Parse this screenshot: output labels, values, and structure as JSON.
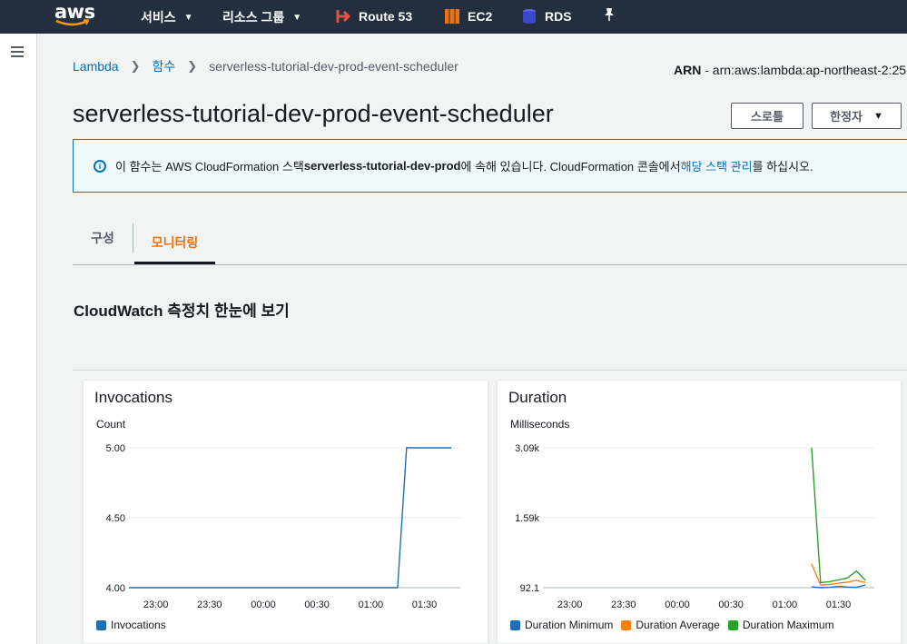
{
  "nav": {
    "logo_text": "aws",
    "services_label": "서비스",
    "resource_groups_label": "리소스 그룹",
    "shortcuts": [
      {
        "label": "Route 53",
        "color": "#e05243",
        "icon": "route53-icon"
      },
      {
        "label": "EC2",
        "color": "#ec7211",
        "icon": "ec2-icon"
      },
      {
        "label": "RDS",
        "color": "#3b48cc",
        "icon": "rds-icon"
      }
    ],
    "pin_icon": "pin-icon"
  },
  "breadcrumb": {
    "root": "Lambda",
    "functions": "함수",
    "current": "serverless-tutorial-dev-prod-event-scheduler"
  },
  "arn": {
    "label": "ARN",
    "value": " - arn:aws:lambda:ap-northeast-2:25"
  },
  "page": {
    "title": "serverless-tutorial-dev-prod-event-scheduler",
    "throttle_label": "스로틀",
    "actions_label": "한정자"
  },
  "info": {
    "prefix": "이 함수는 AWS CloudFormation 스택 ",
    "stack_name": "serverless-tutorial-dev-prod",
    "middle": "에 속해 있습니다. CloudFormation 콘솔에서 ",
    "link": "해당 스택 관리",
    "suffix": "를 하십시오."
  },
  "tabs": [
    {
      "label": "구성",
      "active": false
    },
    {
      "label": "모니터링",
      "active": true
    }
  ],
  "section_title": "CloudWatch 측정치 한눈에 보기",
  "chart_data": [
    {
      "type": "line",
      "title": "Invocations",
      "ylabel": "Count",
      "yticks": [
        "5.00",
        "4.50",
        "4.00"
      ],
      "ylim": [
        4.0,
        5.0
      ],
      "x_ticks": [
        "23:00",
        "23:30",
        "00:00",
        "00:30",
        "01:00",
        "01:30"
      ],
      "x": [
        "22:45",
        "01:15",
        "01:20",
        "01:45"
      ],
      "series": [
        {
          "name": "Invocations",
          "color": "#1f6fb4",
          "values": [
            4.0,
            4.0,
            5.0,
            5.0
          ]
        }
      ],
      "legend": "bottom"
    },
    {
      "type": "line",
      "title": "Duration",
      "ylabel": "Milliseconds",
      "yticks": [
        "3.09k",
        "1.59k",
        "92.1"
      ],
      "ylim": [
        92.1,
        3090
      ],
      "x_ticks": [
        "23:00",
        "23:30",
        "00:00",
        "00:30",
        "01:00",
        "01:30"
      ],
      "x": [
        "01:15",
        "01:20",
        "01:25",
        "01:30",
        "01:35",
        "01:40",
        "01:45"
      ],
      "series": [
        {
          "name": "Duration Minimum",
          "color": "#1f6fb4",
          "values": [
            110,
            92.1,
            100,
            120,
            105,
            100,
            150
          ]
        },
        {
          "name": "Duration Average",
          "color": "#ff7f0e",
          "values": [
            600,
            150,
            160,
            190,
            210,
            250,
            200
          ]
        },
        {
          "name": "Duration Maximum",
          "color": "#2ca02c",
          "values": [
            3090,
            200,
            220,
            260,
            300,
            450,
            250
          ]
        }
      ],
      "legend": "bottom"
    }
  ]
}
